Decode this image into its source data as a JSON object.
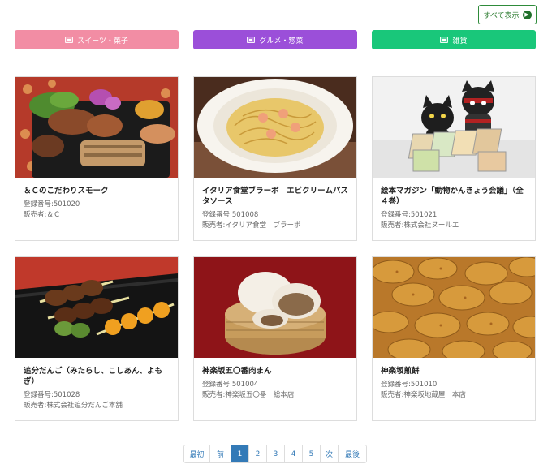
{
  "show_all": {
    "label": "すべて表示"
  },
  "categories": [
    {
      "label": "スイーツ・菓子",
      "color": "#f28da4"
    },
    {
      "label": "グルメ・惣菜",
      "color": "#9b4fd9"
    },
    {
      "label": "雑貨",
      "color": "#19c77a"
    }
  ],
  "products": [
    {
      "title": "＆Ｃのこだわりスモーク",
      "reg": "登録番号:501020",
      "seller": "販売者:＆Ｃ"
    },
    {
      "title": "イタリア食堂ブラーボ　エビクリームパスタソース",
      "reg": "登録番号:501008",
      "seller": "販売者:イタリア食堂　ブラーボ"
    },
    {
      "title": "絵本マガジン「動物かんきょう会議」（全４巻）",
      "reg": "登録番号:501021",
      "seller": "販売者:株式会社ヌールエ"
    },
    {
      "title": "追分だんご（みたらし、こしあん、よもぎ）",
      "reg": "登録番号:501028",
      "seller": "販売者:株式会社追分だんご本舗"
    },
    {
      "title": "神楽坂五〇番肉まん",
      "reg": "登録番号:501004",
      "seller": "販売者:神楽坂五〇番　総本店"
    },
    {
      "title": "神楽坂煎餅",
      "reg": "登録番号:501010",
      "seller": "販売者:神楽坂地蔵屋　本店"
    }
  ],
  "pagination": {
    "first": "最初",
    "prev": "前",
    "pages": [
      "1",
      "2",
      "3",
      "4",
      "5"
    ],
    "next": "次",
    "last": "最後",
    "current": "1"
  }
}
